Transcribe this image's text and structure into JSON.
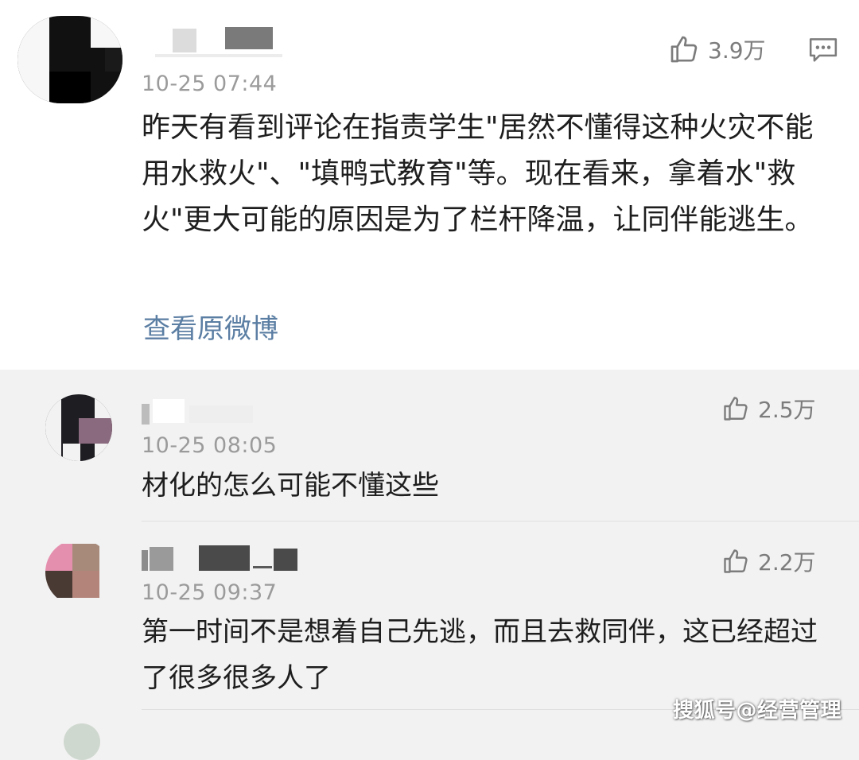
{
  "main_comment": {
    "timestamp": "10-25 07:44",
    "text": "昨天有看到评论在指责学生\"居然不懂得这种火灾不能用水救火\"、\"填鸭式教育\"等。现在看来，拿着水\"救火\"更大可能的原因是为了栏杆降温，让同伴能逃生。",
    "likes": "3.9万",
    "view_original": "查看原微博"
  },
  "replies": [
    {
      "timestamp": "10-25 08:05",
      "text": "材化的怎么可能不懂这些",
      "likes": "2.5万"
    },
    {
      "timestamp": "10-25 09:37",
      "text": "第一时间不是想着自己先逃，而且去救同伴，这已经超过了很多很多人了",
      "likes": "2.2万"
    }
  ],
  "watermark": "搜狐号@经营管理",
  "icons": {
    "like": "thumbs-up-icon",
    "comment": "comment-icon"
  },
  "colors": {
    "link": "#5b7ea3",
    "timestamp": "#9b9b9b",
    "text": "#1e1e1e",
    "background": "#f2f2f2"
  }
}
